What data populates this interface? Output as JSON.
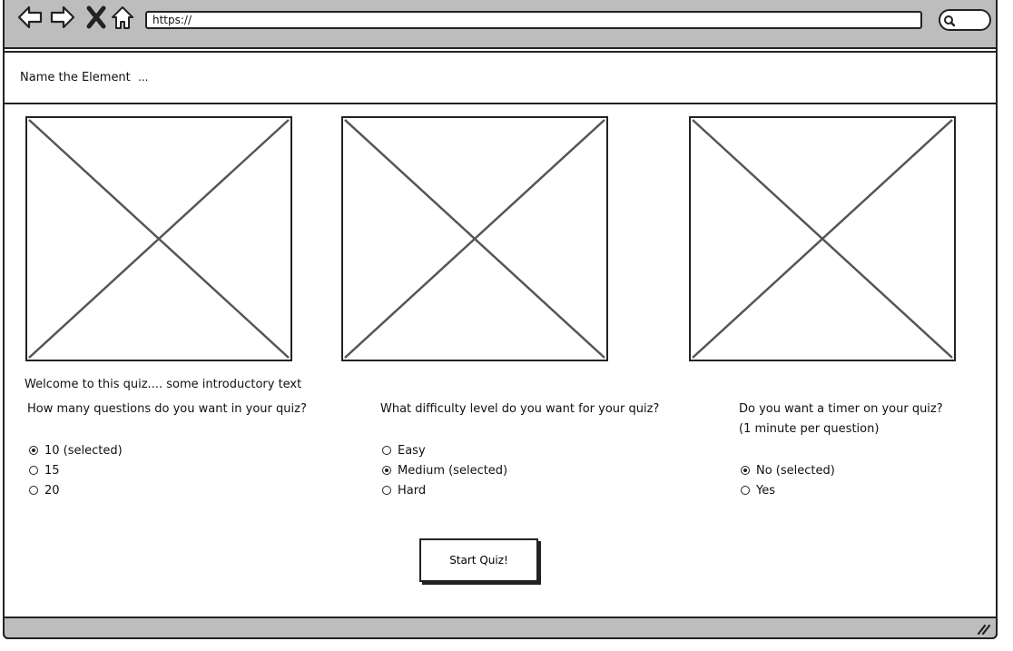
{
  "browser": {
    "url": "https://",
    "icons": [
      "back-arrow-icon",
      "forward-arrow-icon",
      "close-icon",
      "home-icon",
      "search-icon",
      "resize-grip-icon"
    ]
  },
  "header": {
    "site_title": "Name the Element",
    "ellipsis": "..."
  },
  "main": {
    "intro": "Welcome to this quiz.... some introductory text",
    "questions": [
      {
        "label": "How many questions do you want in your quiz?",
        "options": [
          {
            "label": "10 (selected)",
            "selected": true
          },
          {
            "label": "15",
            "selected": false
          },
          {
            "label": "20",
            "selected": false
          }
        ]
      },
      {
        "label": "What difficulty level do you want for your quiz?",
        "options": [
          {
            "label": "Easy",
            "selected": false
          },
          {
            "label": "Medium (selected)",
            "selected": true
          },
          {
            "label": "Hard",
            "selected": false
          }
        ]
      },
      {
        "label": "Do you want a timer on your quiz?",
        "sublabel": "(1 minute per question)",
        "options": [
          {
            "label": "No (selected)",
            "selected": true
          },
          {
            "label": "Yes",
            "selected": false
          }
        ]
      }
    ],
    "start_button": "Start Quiz!"
  }
}
